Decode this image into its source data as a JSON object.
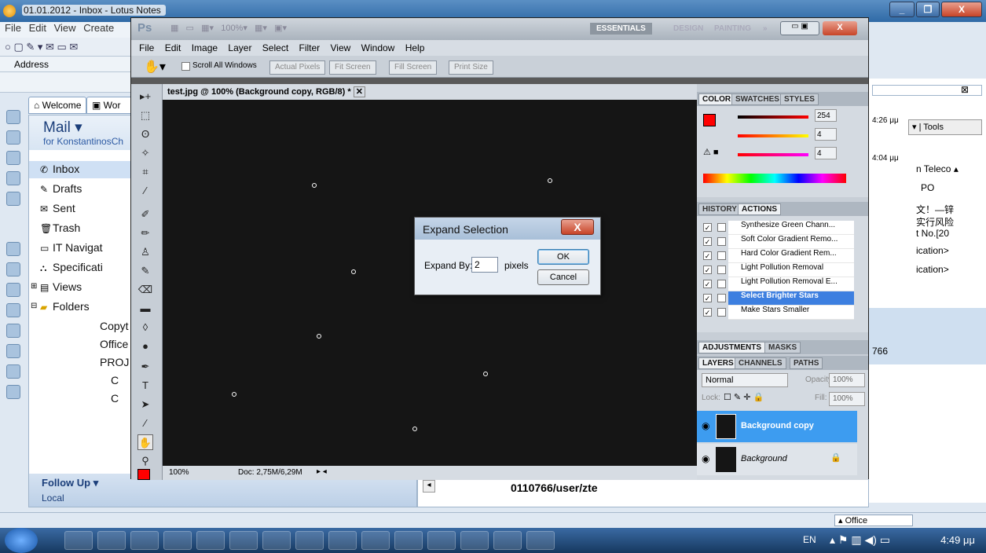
{
  "notes": {
    "title": "01.01.2012 - Inbox - Lotus Notes",
    "menu": [
      "File",
      "Edit",
      "View",
      "Create"
    ],
    "address_label": "Address",
    "tabs": [
      "Welcome",
      "Wor"
    ],
    "mail_title": "Mail ▾",
    "mail_owner": "for KonstantinosCh",
    "nav": [
      "Inbox",
      "Drafts",
      "Sent",
      "Trash",
      "IT Navigat",
      "Specificati",
      "Views",
      "Folders",
      "Copyt",
      "Office",
      "PROJ",
      "C",
      "C"
    ],
    "follow_up": "Follow Up ▾",
    "local": "Local",
    "right_times": [
      "4:26 μμ",
      "4:04 μμ"
    ],
    "right_text": [
      "n Teleco ▴",
      "PO",
      "文！—锌",
      "实行风险",
      "t No.[20",
      "ication>",
      "ication>",
      "766"
    ],
    "tools_label": "Tools",
    "bottom_path": "0110766/user/zte",
    "status_office": "Office"
  },
  "photoshop": {
    "logo": "Ps",
    "workspaces": [
      "ESSENTIALS",
      "DESIGN",
      "PAINTING",
      "»"
    ],
    "menu": [
      "File",
      "Edit",
      "Image",
      "Layer",
      "Select",
      "Filter",
      "View",
      "Window",
      "Help"
    ],
    "options": {
      "scroll_all": "Scroll All Windows",
      "actual": "Actual Pixels",
      "fit": "Fit Screen",
      "fill": "Fill Screen",
      "print": "Print Size"
    },
    "doc_tab": "test.jpg @ 100% (Background copy, RGB/8) *",
    "zoom": "100%",
    "doc_size": "Doc: 2,75M/6,29M",
    "color_tabs": [
      "COLOR",
      "SWATCHES",
      "STYLES"
    ],
    "color_values": {
      "r": "254",
      "g": "4",
      "b": "4"
    },
    "history_tabs": [
      "HISTORY",
      "ACTIONS"
    ],
    "actions": [
      "Synthesize Green Chann...",
      "Soft Color Gradient Remo...",
      "Hard Color Gradient Rem...",
      "Light Pollution Removal",
      "Light Pollution Removal E...",
      "Select Brighter Stars",
      "Make Stars Smaller"
    ],
    "selected_action_index": 5,
    "adj_tabs": [
      "ADJUSTMENTS",
      "MASKS"
    ],
    "layer_tabs": [
      "LAYERS",
      "CHANNELS",
      "PATHS"
    ],
    "blend_mode": "Normal",
    "opacity_label": "Opacity:",
    "opacity": "100%",
    "lock_label": "Lock:",
    "fill_label": "Fill:",
    "fill": "100%",
    "layers": [
      "Background copy",
      "Background"
    ]
  },
  "dialog": {
    "title": "Expand Selection",
    "label": "Expand By:",
    "value": "2",
    "unit": "pixels",
    "ok": "OK",
    "cancel": "Cancel"
  },
  "taskbar": {
    "lang": "EN",
    "time": "4:49 μμ"
  }
}
